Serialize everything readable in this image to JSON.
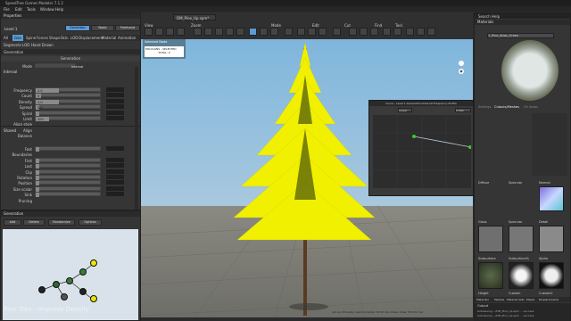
{
  "app": {
    "title": "SpeedTree Games Modeler 7.1.2",
    "menu": [
      "File",
      "Edit",
      "Tools",
      "Window",
      "Help"
    ]
  },
  "properties": {
    "title": "Properties",
    "level": "Level 1",
    "mode_buttons": [
      "Generator",
      "Node",
      "Freehand"
    ],
    "tabs": [
      "All",
      "Gen",
      "Spine",
      "Forces",
      "Shape",
      "Skin",
      "LOD",
      "Displacement",
      "Material",
      "Animation"
    ],
    "subtabs": [
      "Segments",
      "LOD",
      "Hand Drawn"
    ],
    "section": "Generation",
    "generation_header": "Generation",
    "mode_label": "Mode",
    "mode_value": "Interval",
    "interval_header": "Interval",
    "rows": [
      {
        "label": "Frequency",
        "value": "1.0",
        "fill": 0.35
      },
      {
        "label": "Count",
        "value": "0",
        "fill": 0.08
      },
      {
        "label": "Density",
        "value": "1.0",
        "fill": 0.35
      },
      {
        "label": "Spread",
        "value": "0.0",
        "fill": 0.05
      },
      {
        "label": "Spiral",
        "value": "",
        "fill": 0.05
      },
      {
        "label": "Limit",
        "value": "100",
        "fill": 0.2
      },
      {
        "label": "Align style",
        "value": "",
        "fill": 0
      },
      {
        "label": "Align",
        "value": "",
        "fill": 0
      },
      {
        "label": "Balance",
        "value": "",
        "fill": 0
      }
    ],
    "shared_header": "Shared",
    "shared_rows": [
      {
        "label": "Fast",
        "value": "",
        "fill": 0.05
      },
      {
        "label": "Boundaries",
        "value": "",
        "fill": 0
      },
      {
        "label": "First",
        "value": "",
        "fill": 0.05
      },
      {
        "label": "Last",
        "value": "",
        "fill": 0.05
      },
      {
        "label": "Clip",
        "value": "",
        "fill": 0.05
      },
      {
        "label": "Rotation",
        "value": "",
        "fill": 0.05
      },
      {
        "label": "Position",
        "value": "",
        "fill": 0.05
      },
      {
        "label": "Size scalar",
        "value": "",
        "fill": 0.05
      },
      {
        "label": "Sink",
        "value": "",
        "fill": 0.05
      },
      {
        "label": "Pruning",
        "value": "",
        "fill": 0
      }
    ]
  },
  "generation_panel": {
    "title": "Generation",
    "buttons": [
      "Add",
      "Delete",
      "Randomize",
      "Options"
    ]
  },
  "viewport": {
    "tab": "DM_Pine_Up.spm*",
    "toolbar_groups": [
      "View",
      "Mode",
      "Zoom",
      "Edit",
      "Cut",
      "Find",
      "Tool"
    ],
    "overlay": {
      "title": "Selected Node",
      "line1": "POLYGONS - SELECTED",
      "line2": "TOTAL: 0"
    },
    "status": "(all you threads), Last Compute: 59.52 ms (drawn draw: 503.91 ms)"
  },
  "curve": {
    "title": "Curve - Level 1.Generation:Interval:Frequency Profile",
    "dropdown": "Linear",
    "field": "0.500"
  },
  "right": {
    "materials_title": "Materials",
    "material_name": "1_Pine_Atlas_Green",
    "tabs": [
      "Settings",
      "Cutouts/Meshes",
      "UV Areas"
    ],
    "slots": [
      "Diffuse",
      "Specular",
      "Normal",
      "Gloss",
      "Specular",
      "Detail",
      "Subsurface",
      "Subsurface%",
      "Alpha"
    ],
    "extra": [
      "Height",
      "Custom",
      "Custom2"
    ],
    "bottom_tabs": [
      "Materials",
      "Meshes",
      "Material Sets",
      "Masks",
      "Displacements"
    ],
    "output_title": "Output",
    "output_lines": [
      "Autosaving ~/DM_Pine_Up.spm ... success",
      "Autosaving ~/DM_Pine_Up.spm ... success"
    ],
    "search_help": "Search Help"
  },
  "caption": "Pine Tree - Improve Density"
}
